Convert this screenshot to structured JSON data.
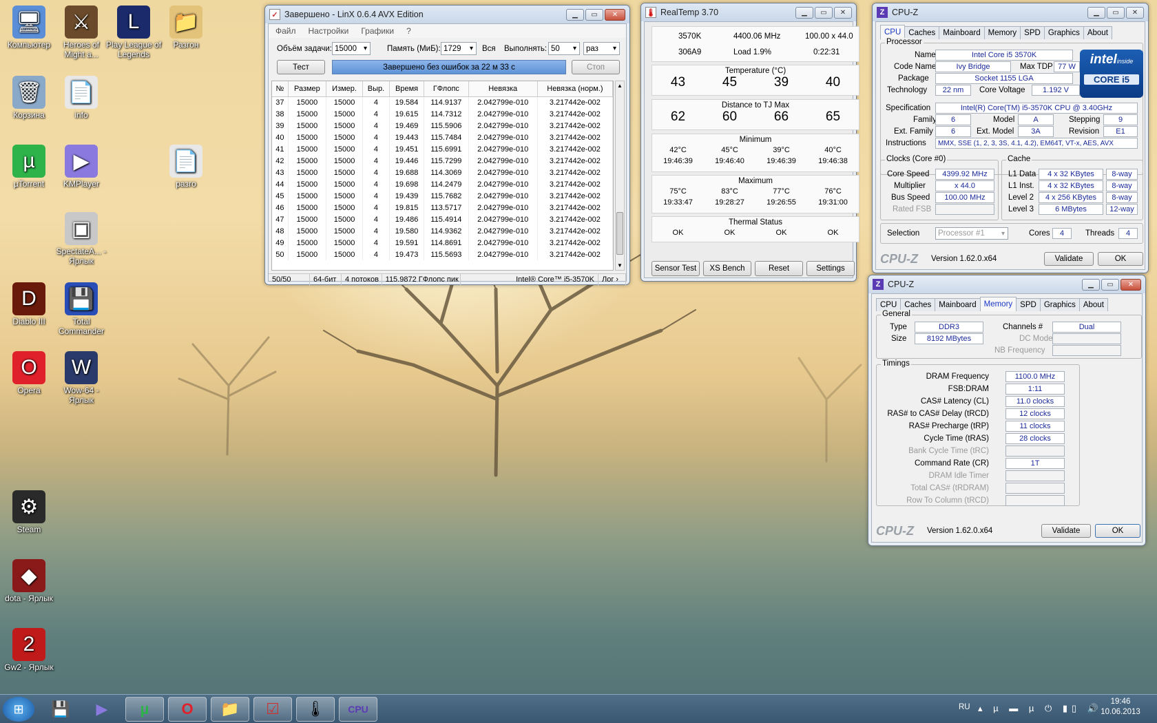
{
  "desktop": {
    "icons": [
      {
        "label": "Компьютер",
        "glyph": "🖥"
      },
      {
        "label": "Heroes of Might a...",
        "glyph": "⚔"
      },
      {
        "label": "Play League of Legends",
        "glyph": "L"
      },
      {
        "label": "Разгон",
        "glyph": "📁"
      },
      {
        "label": "Корзина",
        "glyph": "🗑"
      },
      {
        "label": "info",
        "glyph": "📄"
      },
      {
        "label": "µTorrent",
        "glyph": "µ"
      },
      {
        "label": "KMPlayer",
        "glyph": "▶"
      },
      {
        "label": "разго",
        "glyph": "📄"
      },
      {
        "label": "SpectateA... - Ярлык",
        "glyph": "▣"
      },
      {
        "label": "Diablo III",
        "glyph": "D"
      },
      {
        "label": "Total Commander",
        "glyph": "💾"
      },
      {
        "label": "Opera",
        "glyph": "O"
      },
      {
        "label": "Wow-64 - Ярлык",
        "glyph": "W"
      },
      {
        "label": "Steam",
        "glyph": "⚙"
      },
      {
        "label": "dota - Ярлык",
        "glyph": "◆"
      },
      {
        "label": "Gw2 - Ярлык",
        "glyph": "2"
      }
    ]
  },
  "linx": {
    "title": "Завершено - LinX 0.6.4 AVX Edition",
    "menu": [
      "Файл",
      "Настройки",
      "Графики",
      "?"
    ],
    "task_label": "Объём задачи:",
    "task_value": "15000",
    "mem_label": "Память (МиБ):",
    "mem_value": "1729",
    "all_label": "Вся",
    "runs_label": "Выполнять:",
    "runs_value": "50",
    "runs_unit": "раз",
    "test_btn": "Тест",
    "status": "Завершено без ошибок за 22 м 33 с",
    "stop_btn": "Стоп",
    "columns": [
      "№",
      "Размер",
      "Измер.",
      "Выр.",
      "Время",
      "ГФлопс",
      "Невязка",
      "Невязка (норм.)"
    ],
    "rows": [
      [
        "37",
        "15000",
        "15000",
        "4",
        "19.584",
        "114.9137",
        "2.042799e-010",
        "3.217442e-002"
      ],
      [
        "38",
        "15000",
        "15000",
        "4",
        "19.615",
        "114.7312",
        "2.042799e-010",
        "3.217442e-002"
      ],
      [
        "39",
        "15000",
        "15000",
        "4",
        "19.469",
        "115.5906",
        "2.042799e-010",
        "3.217442e-002"
      ],
      [
        "40",
        "15000",
        "15000",
        "4",
        "19.443",
        "115.7484",
        "2.042799e-010",
        "3.217442e-002"
      ],
      [
        "41",
        "15000",
        "15000",
        "4",
        "19.451",
        "115.6991",
        "2.042799e-010",
        "3.217442e-002"
      ],
      [
        "42",
        "15000",
        "15000",
        "4",
        "19.446",
        "115.7299",
        "2.042799e-010",
        "3.217442e-002"
      ],
      [
        "43",
        "15000",
        "15000",
        "4",
        "19.688",
        "114.3069",
        "2.042799e-010",
        "3.217442e-002"
      ],
      [
        "44",
        "15000",
        "15000",
        "4",
        "19.698",
        "114.2479",
        "2.042799e-010",
        "3.217442e-002"
      ],
      [
        "45",
        "15000",
        "15000",
        "4",
        "19.439",
        "115.7682",
        "2.042799e-010",
        "3.217442e-002"
      ],
      [
        "46",
        "15000",
        "15000",
        "4",
        "19.815",
        "113.5717",
        "2.042799e-010",
        "3.217442e-002"
      ],
      [
        "47",
        "15000",
        "15000",
        "4",
        "19.486",
        "115.4914",
        "2.042799e-010",
        "3.217442e-002"
      ],
      [
        "48",
        "15000",
        "15000",
        "4",
        "19.580",
        "114.9362",
        "2.042799e-010",
        "3.217442e-002"
      ],
      [
        "49",
        "15000",
        "15000",
        "4",
        "19.591",
        "114.8691",
        "2.042799e-010",
        "3.217442e-002"
      ],
      [
        "50",
        "15000",
        "15000",
        "4",
        "19.473",
        "115.5693",
        "2.042799e-010",
        "3.217442e-002"
      ]
    ],
    "statusbar": [
      "50/50",
      "64-бит",
      "4 потоков",
      "115.9872 ГФлопс пик",
      "Intel® Core™ i5-3570K",
      "Лог ›"
    ]
  },
  "realtemp": {
    "title": "RealTemp 3.70",
    "cpu": "3570K",
    "freq": "4400.06 MHz",
    "mult": "100.00 x 44.0",
    "id": "306A9",
    "load": "Load  1.9%",
    "time": "0:22:31",
    "temp_h": "Temperature (°C)",
    "temps": [
      "43",
      "45",
      "39",
      "40"
    ],
    "dist_h": "Distance to TJ Max",
    "dist": [
      "62",
      "60",
      "66",
      "65"
    ],
    "min_h": "Minimum",
    "min": [
      "42°C",
      "45°C",
      "39°C",
      "40°C"
    ],
    "min_t": [
      "19:46:39",
      "19:46:40",
      "19:46:39",
      "19:46:38"
    ],
    "max_h": "Maximum",
    "max": [
      "75°C",
      "83°C",
      "77°C",
      "76°C"
    ],
    "max_t": [
      "19:33:47",
      "19:28:27",
      "19:26:55",
      "19:31:00"
    ],
    "th_h": "Thermal Status",
    "th": [
      "OK",
      "OK",
      "OK",
      "OK"
    ],
    "buttons": [
      "Sensor Test",
      "XS Bench",
      "Reset",
      "Settings"
    ]
  },
  "cpuz1": {
    "title": "CPU-Z",
    "tabs": [
      "CPU",
      "Caches",
      "Mainboard",
      "Memory",
      "SPD",
      "Graphics",
      "About"
    ],
    "processor": "Processor",
    "name_l": "Name",
    "name": "Intel Core i5 3570K",
    "code_l": "Code Name",
    "code": "Ivy Bridge",
    "tdp_l": "Max TDP",
    "tdp": "77 W",
    "pkg_l": "Package",
    "pkg": "Socket 1155 LGA",
    "tech_l": "Technology",
    "tech": "22 nm",
    "volt_l": "Core Voltage",
    "volt": "1.192 V",
    "spec_l": "Specification",
    "spec": "Intel(R) Core(TM) i5-3570K CPU @ 3.40GHz",
    "fam_l": "Family",
    "fam": "6",
    "model_l": "Model",
    "model": "A",
    "step_l": "Stepping",
    "step": "9",
    "efam_l": "Ext. Family",
    "efam": "6",
    "emod_l": "Ext. Model",
    "emod": "3A",
    "rev_l": "Revision",
    "rev": "E1",
    "inst_l": "Instructions",
    "inst": "MMX, SSE (1, 2, 3, 3S, 4.1, 4.2), EM64T, VT-x, AES, AVX",
    "clocks": "Clocks (Core #0)",
    "cs_l": "Core Speed",
    "cs": "4399.92 MHz",
    "mul_l": "Multiplier",
    "mul": "x 44.0",
    "bus_l": "Bus Speed",
    "bus": "100.00 MHz",
    "fsb_l": "Rated FSB",
    "cache": "Cache",
    "l1d_l": "L1 Data",
    "l1d": "4 x 32 KBytes",
    "l1d_w": "8-way",
    "l1i_l": "L1 Inst.",
    "l1i": "4 x 32 KBytes",
    "l1i_w": "8-way",
    "l2_l": "Level 2",
    "l2": "4 x 256 KBytes",
    "l2_w": "8-way",
    "l3_l": "Level 3",
    "l3": "6 MBytes",
    "l3_w": "12-way",
    "sel_l": "Selection",
    "sel": "Processor #1",
    "cores_l": "Cores",
    "cores": "4",
    "thr_l": "Threads",
    "thr": "4",
    "logo": "CPU-Z",
    "ver": "Version 1.62.0.x64",
    "validate": "Validate",
    "ok": "OK",
    "intel_inside": "intel",
    "intel_sub": "inside",
    "intel_core": "CORE i5"
  },
  "cpuz2": {
    "title": "CPU-Z",
    "tabs": [
      "CPU",
      "Caches",
      "Mainboard",
      "Memory",
      "SPD",
      "Graphics",
      "About"
    ],
    "general": "General",
    "type_l": "Type",
    "type": "DDR3",
    "size_l": "Size",
    "size": "8192 MBytes",
    "ch_l": "Channels #",
    "ch": "Dual",
    "dc_l": "DC Mode",
    "nb_l": "NB Frequency",
    "timings": "Timings",
    "t": [
      {
        "l": "DRAM Frequency",
        "v": "1100.0 MHz",
        "on": true
      },
      {
        "l": "FSB:DRAM",
        "v": "1:11",
        "on": true
      },
      {
        "l": "CAS# Latency (CL)",
        "v": "11.0 clocks",
        "on": true
      },
      {
        "l": "RAS# to CAS# Delay (tRCD)",
        "v": "12 clocks",
        "on": true
      },
      {
        "l": "RAS# Precharge (tRP)",
        "v": "11 clocks",
        "on": true
      },
      {
        "l": "Cycle Time (tRAS)",
        "v": "28 clocks",
        "on": true
      },
      {
        "l": "Bank Cycle Time (tRC)",
        "v": "",
        "on": false
      },
      {
        "l": "Command Rate (CR)",
        "v": "1T",
        "on": true
      },
      {
        "l": "DRAM Idle Timer",
        "v": "",
        "on": false
      },
      {
        "l": "Total CAS# (tRDRAM)",
        "v": "",
        "on": false
      },
      {
        "l": "Row To Column (tRCD)",
        "v": "",
        "on": false
      }
    ],
    "logo": "CPU-Z",
    "ver": "Version 1.62.0.x64",
    "validate": "Validate",
    "ok": "OK"
  },
  "taskbar": {
    "lang": "RU",
    "time": "19:46",
    "date": "10.06.2013"
  },
  "colors": {
    "accent": "#1b37c8",
    "progress": "#6b9bd8"
  }
}
